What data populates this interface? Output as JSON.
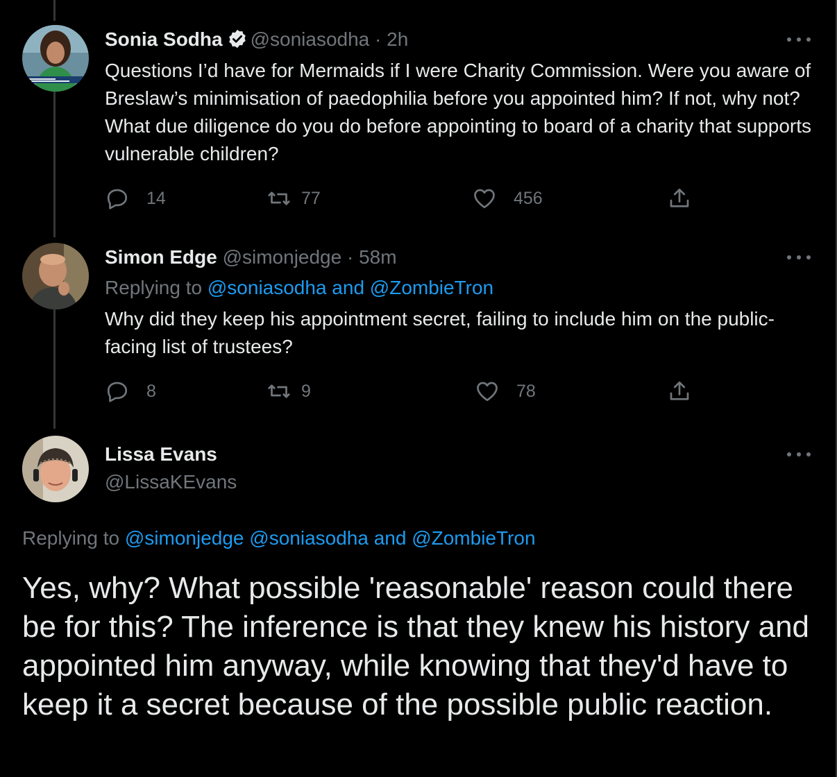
{
  "thread": [
    {
      "name": "Sonia Sodha",
      "verified": true,
      "handle": "@soniasodha",
      "separator": " · ",
      "time": "2h",
      "text": "Questions I’d have for Mermaids if I were Charity Commission. Were you aware of Breslaw’s minimisation of paedophilia before you appointed him? If not, why not? What due diligence do you do before appointing to board of a charity that supports vulnerable children?",
      "replies": "14",
      "retweets": "77",
      "likes": "456"
    },
    {
      "name": "Simon Edge",
      "verified": false,
      "handle": "@simonjedge",
      "separator": " · ",
      "time": "58m",
      "replying_prefix": "Replying to ",
      "replying_links": "@soniasodha and @ZombieTron",
      "text": "Why did they keep his appointment secret, failing to include him on the public-facing list of trustees?",
      "replies": "8",
      "retweets": "9",
      "likes": "78"
    }
  ],
  "main_tweet": {
    "name": "Lissa Evans",
    "handle": "@LissaKEvans",
    "replying_prefix": "Replying to ",
    "replying_links": "@simonjedge @soniasodha and @ZombieTron",
    "text": "Yes, why?  What possible 'reasonable' reason could there be for this?  The inference is that they knew his history and appointed him anyway, while knowing that they'd have to keep it a secret because of the possible public reaction."
  },
  "colors": {
    "background": "#000000",
    "text": "#e7e9ea",
    "muted": "#71767b",
    "link": "#1d9bf0",
    "thread_line": "#333639"
  },
  "icons": {
    "reply": "reply-icon",
    "retweet": "retweet-icon",
    "like": "heart-icon",
    "share": "share-icon",
    "more": "more-dots-icon",
    "verified": "verified-badge-icon"
  }
}
